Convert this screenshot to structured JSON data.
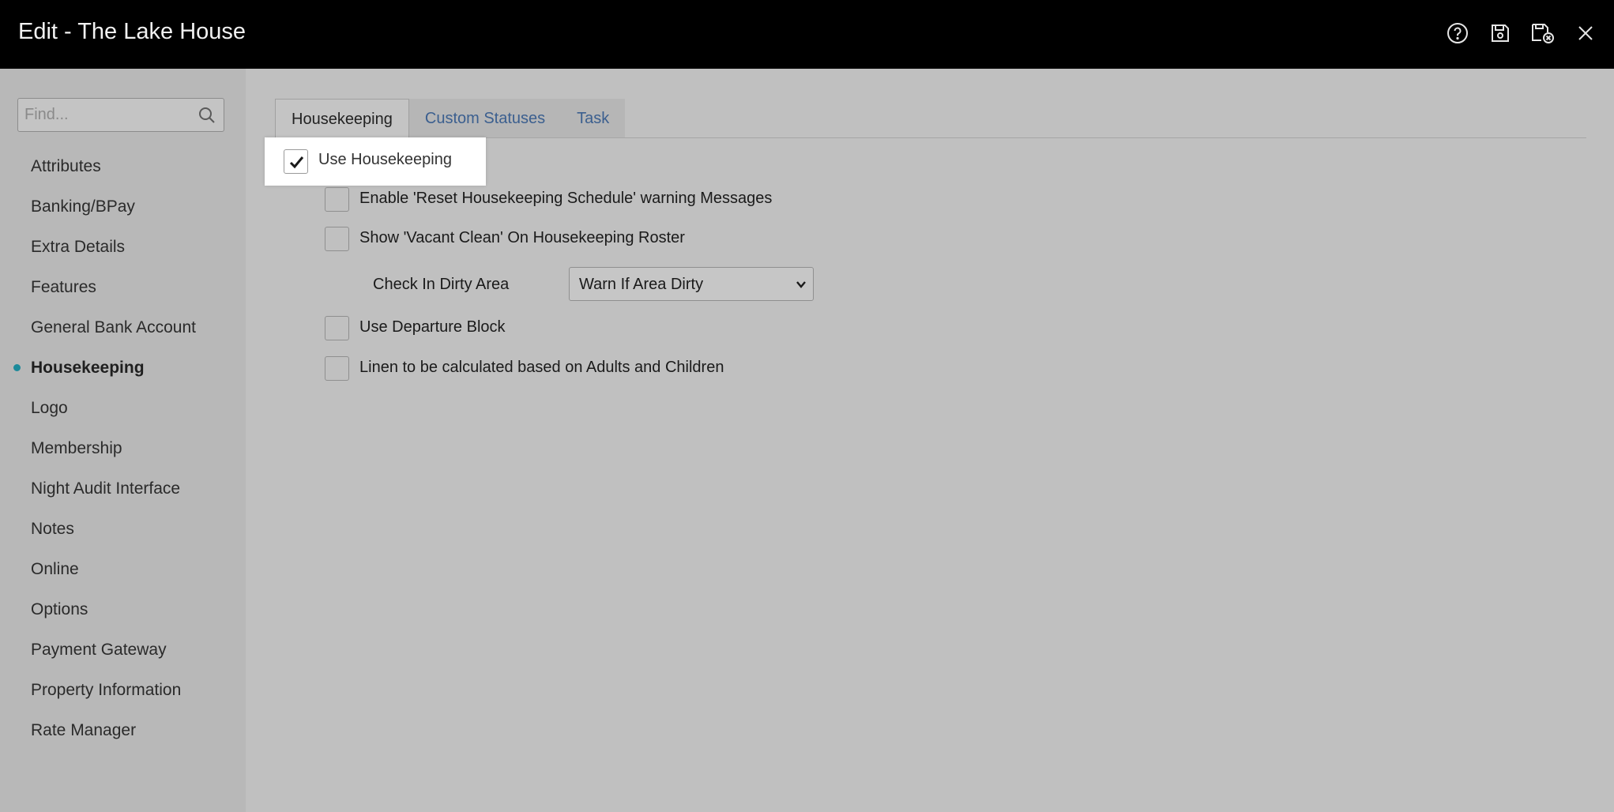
{
  "window": {
    "title": "Edit - The Lake House",
    "actions": [
      {
        "name": "help-icon"
      },
      {
        "name": "save-icon"
      },
      {
        "name": "save-and-close-icon"
      },
      {
        "name": "close-icon"
      }
    ]
  },
  "sidebar": {
    "search_placeholder": "Find...",
    "items": [
      {
        "label": "Attributes",
        "active": false
      },
      {
        "label": "Banking/BPay",
        "active": false
      },
      {
        "label": "Extra Details",
        "active": false
      },
      {
        "label": "Features",
        "active": false
      },
      {
        "label": "General Bank Account",
        "active": false
      },
      {
        "label": "Housekeeping",
        "active": true
      },
      {
        "label": "Logo",
        "active": false
      },
      {
        "label": "Membership",
        "active": false
      },
      {
        "label": "Night Audit Interface",
        "active": false
      },
      {
        "label": "Notes",
        "active": false
      },
      {
        "label": "Online",
        "active": false
      },
      {
        "label": "Options",
        "active": false
      },
      {
        "label": "Payment Gateway",
        "active": false
      },
      {
        "label": "Property Information",
        "active": false
      },
      {
        "label": "Rate Manager",
        "active": false
      }
    ],
    "active_dot_color": "#1b8a9a"
  },
  "tabs": [
    {
      "label": "Housekeeping",
      "active": true
    },
    {
      "label": "Custom Statuses",
      "active": false
    },
    {
      "label": "Task",
      "active": false
    }
  ],
  "form": {
    "use_housekeeping": {
      "label": "Use Housekeeping",
      "checked": true
    },
    "reset_warning": {
      "label": "Enable 'Reset Housekeeping Schedule' warning Messages",
      "checked": false
    },
    "vacant_clean": {
      "label": "Show 'Vacant Clean' On Housekeeping Roster",
      "checked": false
    },
    "check_in_dirty": {
      "label": "Check In Dirty Area",
      "value": "Warn If Area Dirty"
    },
    "departure_block": {
      "label": "Use Departure Block",
      "checked": false
    },
    "linen_calc": {
      "label": "Linen to be calculated based on Adults and Children",
      "checked": false
    }
  }
}
